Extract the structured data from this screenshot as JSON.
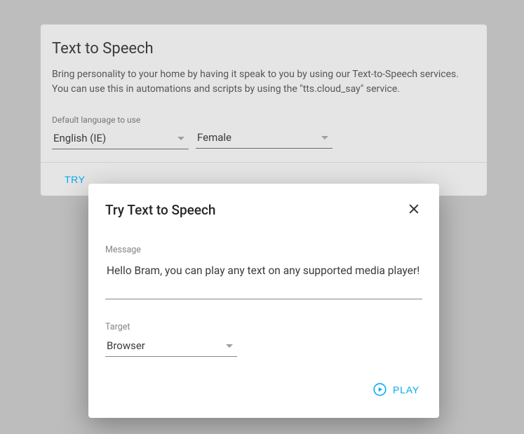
{
  "card": {
    "title": "Text to Speech",
    "description": "Bring personality to your home by having it speak to you by using our Text-to-Speech services. You can use this in automations and scripts by using the \"tts.cloud_say\" service.",
    "fields": {
      "language_label": "Default language to use",
      "language_value": "English (IE)",
      "voice_value": "Female"
    },
    "actions": {
      "try": "TRY"
    }
  },
  "modal": {
    "title": "Try Text to Speech",
    "message_label": "Message",
    "message_value": "Hello Bram, you can play any text on any supported media player!",
    "target_label": "Target",
    "target_value": "Browser",
    "play_label": "PLAY"
  }
}
